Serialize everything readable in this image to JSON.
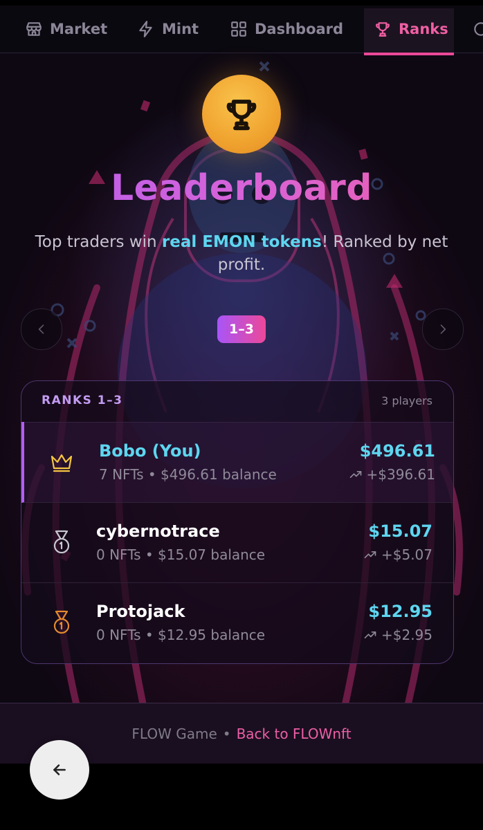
{
  "nav": {
    "items": [
      {
        "label": "Market",
        "icon": "store-icon"
      },
      {
        "label": "Mint",
        "icon": "lightning-icon"
      },
      {
        "label": "Dashboard",
        "icon": "grid-icon"
      },
      {
        "label": "Ranks",
        "icon": "trophy-icon",
        "active": true
      }
    ]
  },
  "hero": {
    "title": "Leaderboard",
    "subtitle_prefix": "Top traders win ",
    "subtitle_highlight": "real EMON tokens",
    "subtitle_suffix": "! Ranked by net profit."
  },
  "pager": {
    "label": "1–3"
  },
  "leaderboard": {
    "header": "RANKS 1–3",
    "players_count": "3 players",
    "rows": [
      {
        "name": "Bobo (You)",
        "details": "7 NFTs • $496.61 balance",
        "amount": "$496.61",
        "gain": "+$396.61",
        "badge": "crown-icon",
        "badge_color": "#f4c542",
        "name_color": "#5ed6f0"
      },
      {
        "name": "cybernotrace",
        "details": "0 NFTs • $15.07 balance",
        "amount": "$15.07",
        "gain": "+$5.07",
        "badge": "silver-medal-icon",
        "badge_color": "#c8c8d0",
        "name_color": "#ffffff"
      },
      {
        "name": "Protojack",
        "details": "0 NFTs • $12.95 balance",
        "amount": "$12.95",
        "gain": "+$2.95",
        "badge": "bronze-medal-icon",
        "badge_color": "#e58a2e",
        "name_color": "#ffffff"
      }
    ]
  },
  "footer": {
    "brand": "FLOW Game",
    "separator": "•",
    "link": "Back to FLOWnft"
  },
  "colors": {
    "accent_pink": "#ec4899",
    "accent_purple": "#a855f7",
    "cyan": "#5ed6f0",
    "trophy_gold": "#f0a32f"
  }
}
